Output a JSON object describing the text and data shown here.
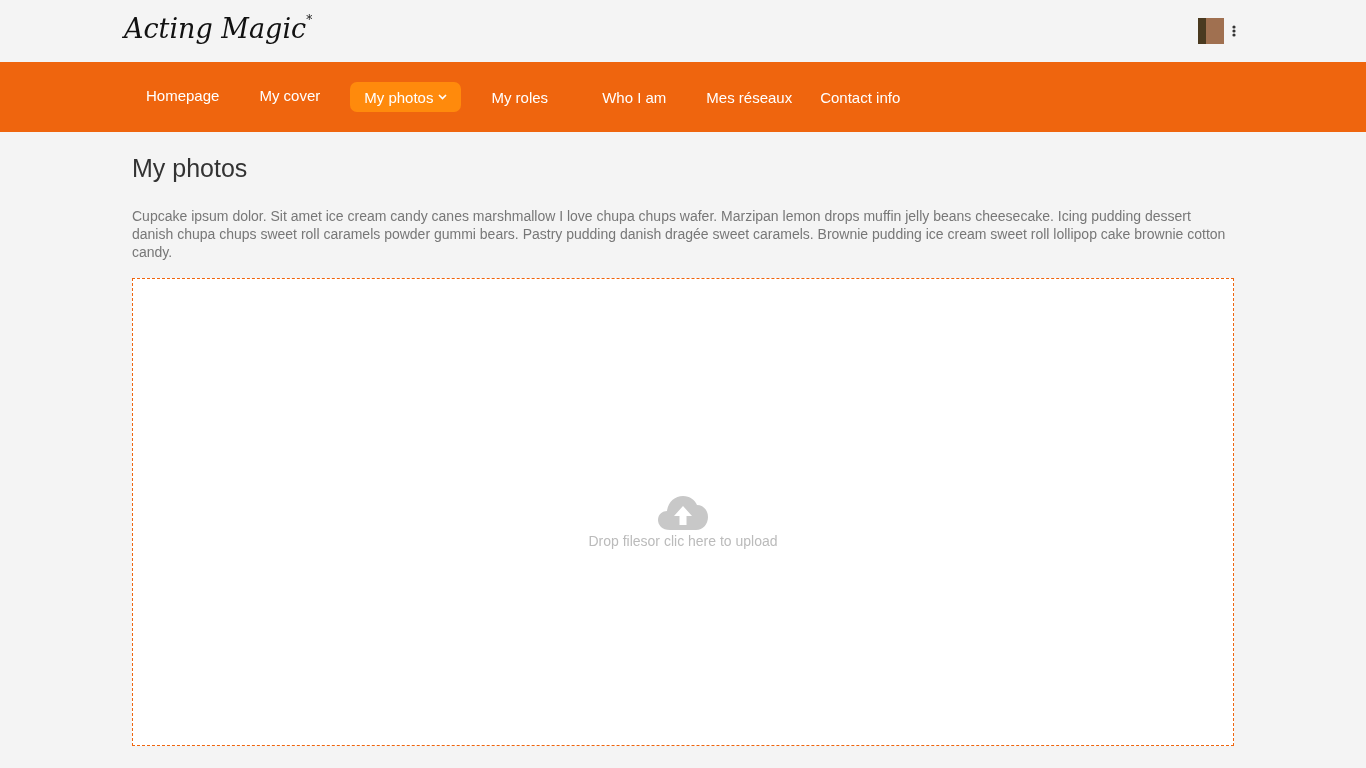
{
  "header": {
    "logo": "Acting Magic",
    "logo_mark": "*"
  },
  "nav": [
    {
      "label": "Homepage",
      "selected": false,
      "dropdown": false
    },
    {
      "label": "My cover",
      "selected": false,
      "dropdown": false
    },
    {
      "label": "My photos",
      "selected": true,
      "dropdown": true
    },
    {
      "label": "My roles",
      "selected": false,
      "dropdown": false
    },
    {
      "label": "Who I am",
      "selected": false,
      "dropdown": false
    },
    {
      "label": "Mes réseaux",
      "selected": false,
      "dropdown": false
    },
    {
      "label": "Contact info",
      "selected": false,
      "dropdown": false
    }
  ],
  "page": {
    "title": "My photos",
    "intro": "Cupcake ipsum dolor. Sit amet ice cream candy canes marshmallow I love chupa chups wafer. Marzipan lemon drops muffin jelly beans cheesecake. Icing pudding dessert danish chupa chups sweet roll caramels powder gummi bears. Pastry pudding danish dragée sweet caramels. Brownie pudding ice cream sweet roll lollipop cake brownie cotton candy.",
    "upload_label": "Drop filesor clic here to upload"
  }
}
